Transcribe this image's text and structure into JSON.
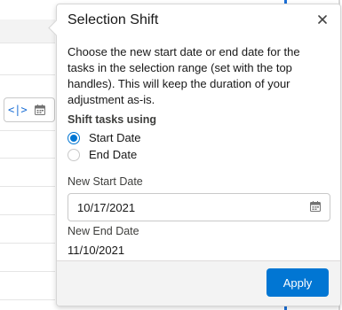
{
  "background": {
    "toolbar_shift_icon_text": "<|>",
    "accent": "#1b6fd6"
  },
  "popover": {
    "title": "Selection Shift",
    "close_icon": "close-icon",
    "description": "Choose the new start date or end date for the tasks in the selection range (set with the top handles). This will keep the duration of your adjustment as-is.",
    "shift_using_label": "Shift tasks using",
    "options": [
      {
        "label": "Start Date",
        "checked": true
      },
      {
        "label": "End Date",
        "checked": false
      }
    ],
    "new_start_date_label": "New Start Date",
    "new_start_date_value": "10/17/2021",
    "new_end_date_label": "New End Date",
    "new_end_date_value": "11/10/2021",
    "apply_label": "Apply",
    "brand_color": "#0176d3"
  }
}
